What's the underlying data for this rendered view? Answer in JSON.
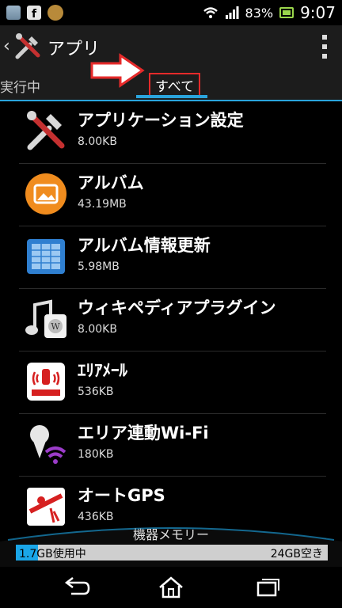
{
  "statusbar": {
    "battery": "83%",
    "time": "9:07"
  },
  "actionbar": {
    "title": "アプリ"
  },
  "tabs": [
    {
      "label": "実行中"
    },
    {
      "label": "すべて"
    }
  ],
  "apps": [
    {
      "name": "アプリケーション設定",
      "size": "8.00KB",
      "icon": "tools-icon"
    },
    {
      "name": "アルバム",
      "size": "43.19MB",
      "icon": "album-icon"
    },
    {
      "name": "アルバム情報更新",
      "size": "5.98MB",
      "icon": "album-update-icon"
    },
    {
      "name": "ウィキペディアプラグイン",
      "size": "8.00KB",
      "icon": "wikipedia-plugin-icon"
    },
    {
      "name": "ｴﾘｱﾒｰﾙ",
      "size": "536KB",
      "icon": "area-mail-icon"
    },
    {
      "name": "エリア連動Wi-Fi",
      "size": "180KB",
      "icon": "area-wifi-icon"
    },
    {
      "name": "オートGPS",
      "size": "436KB",
      "icon": "auto-gps-icon"
    }
  ],
  "memory": {
    "label": "機器メモリー",
    "used": "1.7GB使用中",
    "free": "24GB空き",
    "used_fraction": 0.07
  },
  "colors": {
    "accent": "#2aa4dc",
    "highlight": "#e52a2a"
  }
}
